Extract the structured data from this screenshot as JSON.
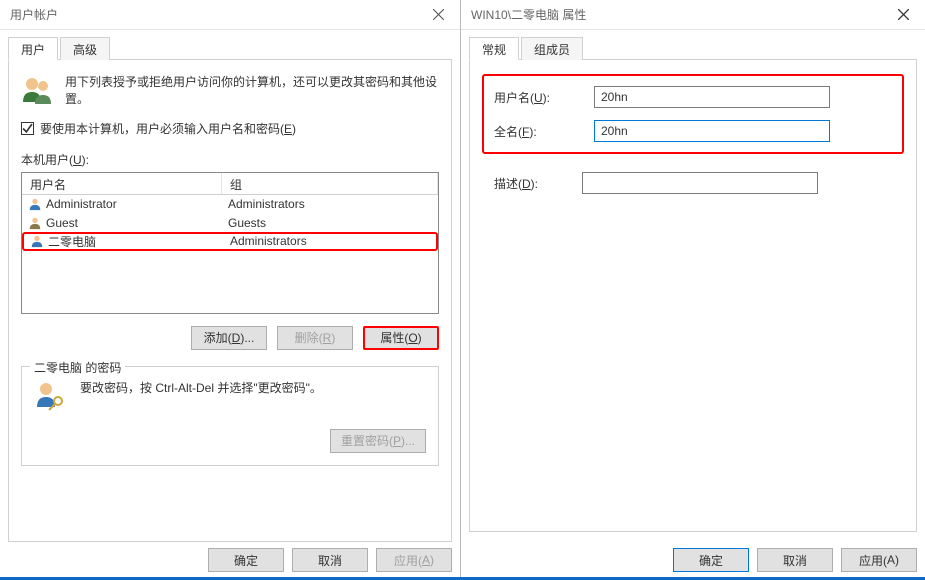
{
  "left": {
    "title": "用户帐户",
    "tabs": {
      "user": "用户",
      "advanced": "高级"
    },
    "intro": "用下列表授予或拒绝用户访问你的计算机，还可以更改其密码和其他设置。",
    "checkbox_label_pre": "要使用本计算机，用户必须输入用户名和密码(",
    "checkbox_hotkey": "E",
    "checkbox_label_post": ")",
    "users_label_pre": "本机用户(",
    "users_label_hotkey": "U",
    "users_label_post": "):",
    "columns": {
      "name": "用户名",
      "group": "组"
    },
    "rows": [
      {
        "name": "Administrator",
        "group": "Administrators"
      },
      {
        "name": "Guest",
        "group": "Guests"
      },
      {
        "name": "二零电脑",
        "group": "Administrators"
      }
    ],
    "buttons": {
      "add_pre": "添加(",
      "add_hot": "D",
      "add_post": ")...",
      "remove_pre": "删除(",
      "remove_hot": "R",
      "remove_post": ")",
      "props_pre": "属性(",
      "props_hot": "O",
      "props_post": ")"
    },
    "group_title": "二零电脑 的密码",
    "pwd_text": "要改密码，按 Ctrl-Alt-Del 并选择\"更改密码\"。",
    "reset_pre": "重置密码(",
    "reset_hot": "P",
    "reset_post": ")...",
    "ok": "确定",
    "cancel": "取消",
    "apply_pre": "应用(",
    "apply_hot": "A",
    "apply_post": ")"
  },
  "right": {
    "title": "WIN10\\二零电脑 属性",
    "tabs": {
      "general": "常规",
      "members": "组成员"
    },
    "labels": {
      "user_pre": "用户名(",
      "user_hot": "U",
      "user_post": "):",
      "full_pre": "全名(",
      "full_hot": "F",
      "full_post": "):",
      "desc_pre": "描述(",
      "desc_hot": "D",
      "desc_post": "):"
    },
    "values": {
      "username": "20hn",
      "fullname": "20hn",
      "description": ""
    },
    "ok": "确定",
    "cancel": "取消",
    "apply_pre": "应用(",
    "apply_hot": "A",
    "apply_post": ")"
  }
}
